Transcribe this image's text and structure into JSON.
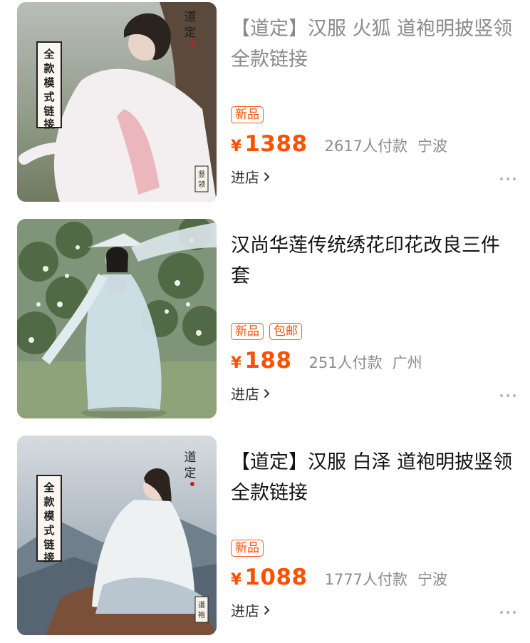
{
  "colors": {
    "accent": "#ff5000",
    "muted": "#8c8c8c"
  },
  "items": [
    {
      "title": "【道定】汉服 火狐 道袍明披竖领 全款链接",
      "tags": [
        "新品"
      ],
      "currency": "¥",
      "price": "1388",
      "paid": "2617人付款",
      "city": "宁波",
      "shop_label": "进店",
      "image_text": {
        "vertical_box": "全款模式链接",
        "corner_mark": "竖领",
        "seal": "道定"
      }
    },
    {
      "title": "汉尚华莲传统绣花印花改良三件套",
      "tags": [
        "新品",
        "包邮"
      ],
      "currency": "¥",
      "price": "188",
      "paid": "251人付款",
      "city": "广州",
      "shop_label": "进店"
    },
    {
      "title": "【道定】汉服 白泽 道袍明披竖领 全款链接",
      "tags": [
        "新品"
      ],
      "currency": "¥",
      "price": "1088",
      "paid": "1777人付款",
      "city": "宁波",
      "shop_label": "进店",
      "image_text": {
        "vertical_box": "全款模式链接",
        "corner_mark": "道袍",
        "seal": "道定"
      }
    }
  ]
}
